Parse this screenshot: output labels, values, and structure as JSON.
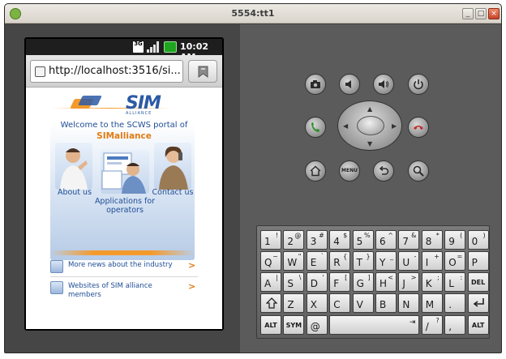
{
  "window": {
    "title": "5554:tt1"
  },
  "statusbar": {
    "network": "3G",
    "time": "10:02 AM"
  },
  "browser": {
    "url": "http://localhost:3516/si..."
  },
  "page": {
    "welcome": "Welcome to the SCWS portal of",
    "brand": "SIMalliance",
    "logo_text": "SIM",
    "logo_sub": "ALLIANCE",
    "tiles": {
      "about": "About us",
      "apps": "Applications for operators",
      "contact": "Contact us"
    },
    "links": [
      {
        "text": "More news about the industry",
        "arrow": ">"
      },
      {
        "text": "Websites of SIM alliance members",
        "arrow": ">"
      }
    ]
  },
  "controls": {
    "menu_label": "MENU"
  },
  "keyboard": {
    "row1": [
      {
        "main": "1",
        "alt": "!"
      },
      {
        "main": "2",
        "alt": "@"
      },
      {
        "main": "3",
        "alt": "#"
      },
      {
        "main": "4",
        "alt": "$"
      },
      {
        "main": "5",
        "alt": "%"
      },
      {
        "main": "6",
        "alt": "^"
      },
      {
        "main": "7",
        "alt": "&"
      },
      {
        "main": "8",
        "alt": "*"
      },
      {
        "main": "9",
        "alt": "("
      },
      {
        "main": "0",
        "alt": ")"
      }
    ],
    "row2": [
      {
        "main": "Q",
        "alt": "~"
      },
      {
        "main": "W",
        "alt": "\""
      },
      {
        "main": "E",
        "alt": "`"
      },
      {
        "main": "R",
        "alt": "{"
      },
      {
        "main": "T",
        "alt": "}"
      },
      {
        "main": "Y",
        "alt": "_"
      },
      {
        "main": "U",
        "alt": "-"
      },
      {
        "main": "I",
        "alt": "+"
      },
      {
        "main": "O",
        "alt": "="
      },
      {
        "main": "P",
        "alt": ""
      }
    ],
    "row3": [
      {
        "main": "A",
        "alt": "|"
      },
      {
        "main": "S",
        "alt": "\\"
      },
      {
        "main": "D",
        "alt": "'"
      },
      {
        "main": "F",
        "alt": "["
      },
      {
        "main": "G",
        "alt": "]"
      },
      {
        "main": "H",
        "alt": "<"
      },
      {
        "main": "J",
        "alt": ">"
      },
      {
        "main": "K",
        "alt": ";"
      },
      {
        "main": "L",
        "alt": ":"
      }
    ],
    "del_label": "DEL",
    "row4": [
      {
        "main": "Z",
        "alt": ""
      },
      {
        "main": "X",
        "alt": ""
      },
      {
        "main": "C",
        "alt": ""
      },
      {
        "main": "V",
        "alt": ""
      },
      {
        "main": "B",
        "alt": ""
      },
      {
        "main": "N",
        "alt": ""
      },
      {
        "main": "M",
        "alt": ""
      },
      {
        "main": ".",
        "alt": ""
      }
    ],
    "row5": {
      "alt": "ALT",
      "sym": "SYM",
      "at": "@",
      "slash": "/",
      "question": "?",
      "comma": ",",
      "alt2": "ALT"
    }
  }
}
